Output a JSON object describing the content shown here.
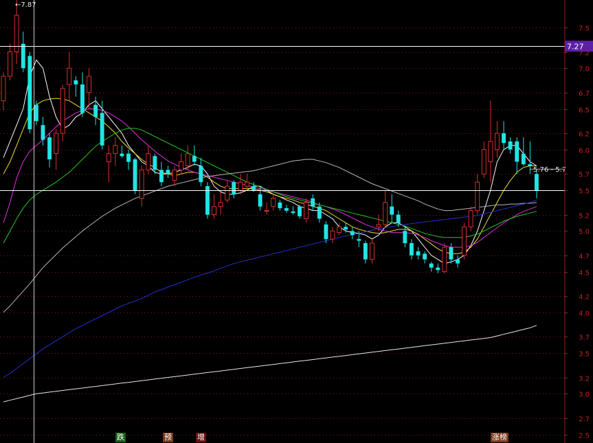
{
  "chart_data": {
    "type": "candlestick",
    "ylim": [
      2.45,
      7.85
    ],
    "y_ticks": [
      "7.5",
      "7.2",
      "7.0",
      "6.7",
      "6.5",
      "6.2",
      "6.0",
      "5.7",
      "5.5",
      "5.2",
      "5.0",
      "4.7",
      "4.5",
      "4.2",
      "4.0",
      "3.7",
      "3.5",
      "3.2",
      "3.0",
      "2.7",
      "2.5"
    ],
    "grid": true,
    "price_tag": "7.27",
    "high_label": "7.87",
    "cursor_label": "5.76 - 5.7",
    "hlines": [
      7.27,
      5.5
    ],
    "colors": {
      "up": "#d83030",
      "down": "#22e4e4",
      "tag_bg": "#5b1fa8",
      "axis": "#a61c1c"
    },
    "candles": [
      [
        6.6,
        6.95,
        6.48,
        6.9
      ],
      [
        6.9,
        7.3,
        6.85,
        7.2
      ],
      [
        7.2,
        7.85,
        7.05,
        7.65
      ],
      [
        7.3,
        7.45,
        6.95,
        7.0
      ],
      [
        7.15,
        7.2,
        6.2,
        6.25
      ],
      [
        6.55,
        6.6,
        6.3,
        6.35
      ],
      [
        6.3,
        6.4,
        6.05,
        6.12
      ],
      [
        6.15,
        6.2,
        5.78,
        5.88
      ],
      [
        5.95,
        6.25,
        5.75,
        6.2
      ],
      [
        6.2,
        6.8,
        6.1,
        6.75
      ],
      [
        6.8,
        7.2,
        6.6,
        7.0
      ],
      [
        6.85,
        6.9,
        6.65,
        6.8
      ],
      [
        6.8,
        6.95,
        6.4,
        6.45
      ],
      [
        6.7,
        7.0,
        6.5,
        6.9
      ],
      [
        6.55,
        6.65,
        6.3,
        6.4
      ],
      [
        6.45,
        6.6,
        6.0,
        6.05
      ],
      [
        5.85,
        6.05,
        5.6,
        5.95
      ],
      [
        5.95,
        6.15,
        5.8,
        6.05
      ],
      [
        5.95,
        6.05,
        5.9,
        5.92
      ],
      [
        5.95,
        6.0,
        5.75,
        5.85
      ],
      [
        5.88,
        5.9,
        5.45,
        5.5
      ],
      [
        5.4,
        5.8,
        5.3,
        5.75
      ],
      [
        5.75,
        6.05,
        5.7,
        5.95
      ],
      [
        5.92,
        5.95,
        5.7,
        5.75
      ],
      [
        5.75,
        5.85,
        5.55,
        5.6
      ],
      [
        5.75,
        5.8,
        5.65,
        5.7
      ],
      [
        5.62,
        5.8,
        5.55,
        5.75
      ],
      [
        5.75,
        5.95,
        5.7,
        5.85
      ],
      [
        5.8,
        6.05,
        5.75,
        5.95
      ],
      [
        5.92,
        6.05,
        5.8,
        5.85
      ],
      [
        5.8,
        5.9,
        5.55,
        5.6
      ],
      [
        5.55,
        5.6,
        5.15,
        5.2
      ],
      [
        5.2,
        5.45,
        5.15,
        5.3
      ],
      [
        5.3,
        5.5,
        5.2,
        5.35
      ],
      [
        5.38,
        5.62,
        5.35,
        5.55
      ],
      [
        5.6,
        5.62,
        5.4,
        5.45
      ],
      [
        5.5,
        5.7,
        5.45,
        5.6
      ],
      [
        5.55,
        5.7,
        5.5,
        5.6
      ],
      [
        5.55,
        5.6,
        5.48,
        5.5
      ],
      [
        5.45,
        5.55,
        5.25,
        5.3
      ],
      [
        5.25,
        5.35,
        5.2,
        5.25
      ],
      [
        5.3,
        5.45,
        5.25,
        5.4
      ],
      [
        5.35,
        5.38,
        5.25,
        5.28
      ],
      [
        5.28,
        5.32,
        5.22,
        5.25
      ],
      [
        5.24,
        5.3,
        5.2,
        5.22
      ],
      [
        5.3,
        5.32,
        5.15,
        5.18
      ],
      [
        5.15,
        5.4,
        5.1,
        5.35
      ],
      [
        5.4,
        5.45,
        5.25,
        5.3
      ],
      [
        5.3,
        5.35,
        5.1,
        5.15
      ],
      [
        5.08,
        5.12,
        4.85,
        4.9
      ],
      [
        4.9,
        5.05,
        4.85,
        5.0
      ],
      [
        4.98,
        5.1,
        4.95,
        5.05
      ],
      [
        5.05,
        5.1,
        4.98,
        5.02
      ],
      [
        5.0,
        5.05,
        4.9,
        4.95
      ],
      [
        4.9,
        5.0,
        4.8,
        4.88
      ],
      [
        4.85,
        4.88,
        4.6,
        4.65
      ],
      [
        4.65,
        4.9,
        4.6,
        4.85
      ],
      [
        5.05,
        5.2,
        5.0,
        5.08
      ],
      [
        5.08,
        5.5,
        5.05,
        5.35
      ],
      [
        5.3,
        5.45,
        5.1,
        5.2
      ],
      [
        5.2,
        5.25,
        5.05,
        5.1
      ],
      [
        5.0,
        5.05,
        4.8,
        4.85
      ],
      [
        4.85,
        4.9,
        4.65,
        4.7
      ],
      [
        4.75,
        4.8,
        4.65,
        4.7
      ],
      [
        4.72,
        4.75,
        4.6,
        4.65
      ],
      [
        4.6,
        4.62,
        4.5,
        4.55
      ],
      [
        4.55,
        4.6,
        4.48,
        4.52
      ],
      [
        4.5,
        4.85,
        4.48,
        4.8
      ],
      [
        4.8,
        4.85,
        4.6,
        4.65
      ],
      [
        4.65,
        4.7,
        4.55,
        4.6
      ],
      [
        4.7,
        5.1,
        4.65,
        5.05
      ],
      [
        5.05,
        5.3,
        5.0,
        5.25
      ],
      [
        5.25,
        5.7,
        5.2,
        5.6
      ],
      [
        5.7,
        6.1,
        5.65,
        6.0
      ],
      [
        5.85,
        6.6,
        5.6,
        6.1
      ],
      [
        6.0,
        6.35,
        5.9,
        6.2
      ],
      [
        6.2,
        6.35,
        6.0,
        6.08
      ],
      [
        6.1,
        6.15,
        5.95,
        6.0
      ],
      [
        6.1,
        6.15,
        5.7,
        5.85
      ],
      [
        5.95,
        6.15,
        5.8,
        5.82
      ],
      [
        5.82,
        6.1,
        5.7,
        5.8
      ],
      [
        5.7,
        5.75,
        5.4,
        5.5
      ]
    ],
    "ma_lines": [
      {
        "color": "#ffffff",
        "values": [
          5.9,
          6.1,
          6.3,
          6.5,
          6.9,
          7.1,
          7.0,
          6.65,
          6.4,
          6.25,
          6.3,
          6.4,
          6.45,
          6.55,
          6.6,
          6.5,
          6.4,
          6.3,
          6.2,
          6.05,
          5.95,
          5.85,
          5.8,
          5.72,
          5.7,
          5.7,
          5.72,
          5.75,
          5.78,
          5.82,
          5.8,
          5.7,
          5.55,
          5.48,
          5.45,
          5.45,
          5.47,
          5.5,
          5.55,
          5.55,
          5.5,
          5.45,
          5.42,
          5.38,
          5.35,
          5.3,
          5.28,
          5.25,
          5.25,
          5.2,
          5.15,
          5.05,
          5.0,
          4.98,
          4.97,
          4.95,
          4.9,
          4.95,
          5.05,
          5.1,
          5.1,
          5.05,
          5.0,
          4.9,
          4.8,
          4.7,
          4.65,
          4.6,
          4.62,
          4.65,
          4.7,
          4.82,
          5.0,
          5.25,
          5.5,
          5.85,
          6.0,
          6.05,
          6.05,
          5.95,
          5.85,
          5.8
        ]
      },
      {
        "color": "#f0e030",
        "values": [
          5.7,
          5.85,
          6.05,
          6.25,
          6.45,
          6.55,
          6.6,
          6.62,
          6.63,
          6.62,
          6.6,
          6.55,
          6.5,
          6.45,
          6.4,
          6.35,
          6.28,
          6.2,
          6.1,
          6.02,
          5.95,
          5.88,
          5.82,
          5.78,
          5.72,
          5.7,
          5.68,
          5.7,
          5.72,
          5.72,
          5.7,
          5.66,
          5.6,
          5.55,
          5.52,
          5.52,
          5.52,
          5.52,
          5.52,
          5.5,
          5.48,
          5.45,
          5.42,
          5.4,
          5.38,
          5.35,
          5.33,
          5.3,
          5.28,
          5.25,
          5.2,
          5.15,
          5.1,
          5.05,
          5.02,
          5.0,
          4.98,
          4.97,
          4.98,
          5.0,
          5.02,
          5.02,
          5.0,
          4.96,
          4.9,
          4.84,
          4.78,
          4.74,
          4.72,
          4.72,
          4.74,
          4.8,
          4.9,
          5.05,
          5.2,
          5.35,
          5.5,
          5.62,
          5.72,
          5.78,
          5.8,
          5.8
        ]
      },
      {
        "color": "#e030e0",
        "values": [
          5.1,
          5.35,
          5.65,
          5.85,
          5.98,
          6.05,
          6.12,
          6.2,
          6.28,
          6.35,
          6.4,
          6.45,
          6.48,
          6.5,
          6.5,
          6.48,
          6.45,
          6.4,
          6.35,
          6.28,
          6.2,
          6.12,
          6.05,
          5.98,
          5.92,
          5.86,
          5.82,
          5.78,
          5.75,
          5.72,
          5.7,
          5.68,
          5.66,
          5.64,
          5.62,
          5.6,
          5.58,
          5.56,
          5.54,
          5.52,
          5.5,
          5.48,
          5.46,
          5.44,
          5.42,
          5.4,
          5.38,
          5.35,
          5.32,
          5.3,
          5.27,
          5.24,
          5.2,
          5.16,
          5.12,
          5.08,
          5.05,
          5.02,
          5.0,
          4.98,
          4.98,
          4.98,
          4.97,
          4.95,
          4.92,
          4.88,
          4.85,
          4.82,
          4.8,
          4.8,
          4.8,
          4.82,
          4.86,
          4.92,
          4.98,
          5.04,
          5.1,
          5.15,
          5.2,
          5.24,
          5.27,
          5.3
        ]
      },
      {
        "color": "#28c828",
        "values": [
          4.85,
          5.0,
          5.15,
          5.28,
          5.38,
          5.45,
          5.5,
          5.55,
          5.6,
          5.66,
          5.72,
          5.8,
          5.88,
          5.96,
          6.04,
          6.1,
          6.15,
          6.2,
          6.24,
          6.26,
          6.26,
          6.24,
          6.2,
          6.16,
          6.12,
          6.08,
          6.04,
          6.0,
          5.96,
          5.92,
          5.88,
          5.84,
          5.8,
          5.76,
          5.72,
          5.68,
          5.64,
          5.6,
          5.57,
          5.54,
          5.51,
          5.48,
          5.45,
          5.42,
          5.4,
          5.38,
          5.36,
          5.34,
          5.32,
          5.3,
          5.28,
          5.26,
          5.24,
          5.22,
          5.2,
          5.18,
          5.16,
          5.14,
          5.12,
          5.1,
          5.08,
          5.06,
          5.03,
          5.0,
          4.97,
          4.95,
          4.93,
          4.92,
          4.92,
          4.92,
          4.92,
          4.94,
          4.96,
          5.0,
          5.04,
          5.08,
          5.12,
          5.15,
          5.18,
          5.2,
          5.22,
          5.24
        ]
      },
      {
        "color": "#b8b8b8",
        "values": [
          4.0,
          4.08,
          4.17,
          4.26,
          4.35,
          4.45,
          4.55,
          4.63,
          4.71,
          4.79,
          4.86,
          4.93,
          5.0,
          5.06,
          5.12,
          5.18,
          5.23,
          5.28,
          5.32,
          5.36,
          5.4,
          5.43,
          5.46,
          5.49,
          5.52,
          5.55,
          5.57,
          5.59,
          5.61,
          5.63,
          5.65,
          5.67,
          5.68,
          5.69,
          5.7,
          5.71,
          5.72,
          5.73,
          5.74,
          5.76,
          5.78,
          5.8,
          5.82,
          5.84,
          5.86,
          5.87,
          5.88,
          5.88,
          5.86,
          5.84,
          5.81,
          5.78,
          5.74,
          5.7,
          5.66,
          5.62,
          5.58,
          5.55,
          5.52,
          5.49,
          5.46,
          5.43,
          5.4,
          5.37,
          5.33,
          5.3,
          5.27,
          5.25,
          5.25,
          5.26,
          5.27,
          5.28,
          5.29,
          5.3,
          5.31,
          5.32,
          5.32,
          5.33,
          5.33,
          5.34,
          5.34,
          5.35
        ]
      },
      {
        "color": "#2830c8",
        "values": [
          3.2,
          3.25,
          3.31,
          3.37,
          3.43,
          3.49,
          3.55,
          3.6,
          3.65,
          3.7,
          3.75,
          3.8,
          3.84,
          3.88,
          3.92,
          3.96,
          4.0,
          4.04,
          4.08,
          4.11,
          4.14,
          4.17,
          4.21,
          4.25,
          4.28,
          4.31,
          4.34,
          4.37,
          4.4,
          4.43,
          4.46,
          4.48,
          4.51,
          4.54,
          4.57,
          4.6,
          4.62,
          4.64,
          4.66,
          4.68,
          4.7,
          4.72,
          4.74,
          4.76,
          4.78,
          4.8,
          4.82,
          4.84,
          4.86,
          4.88,
          4.9,
          4.92,
          4.94,
          4.95,
          4.97,
          4.99,
          5.01,
          5.03,
          5.04,
          5.05,
          5.07,
          5.08,
          5.09,
          5.1,
          5.11,
          5.12,
          5.13,
          5.14,
          5.15,
          5.16,
          5.17,
          5.18,
          5.19,
          5.21,
          5.23,
          5.25,
          5.27,
          5.29,
          5.31,
          5.33,
          5.35,
          5.38
        ]
      },
      {
        "color": "#e8e8e8",
        "values": [
          2.9,
          2.92,
          2.94,
          2.96,
          2.98,
          3.0,
          3.01,
          3.02,
          3.03,
          3.04,
          3.05,
          3.06,
          3.07,
          3.08,
          3.09,
          3.1,
          3.11,
          3.12,
          3.13,
          3.14,
          3.15,
          3.16,
          3.17,
          3.18,
          3.19,
          3.2,
          3.21,
          3.22,
          3.23,
          3.24,
          3.25,
          3.26,
          3.27,
          3.28,
          3.29,
          3.3,
          3.31,
          3.32,
          3.33,
          3.34,
          3.35,
          3.36,
          3.37,
          3.38,
          3.39,
          3.4,
          3.41,
          3.42,
          3.43,
          3.44,
          3.45,
          3.46,
          3.47,
          3.48,
          3.49,
          3.5,
          3.51,
          3.52,
          3.53,
          3.54,
          3.55,
          3.56,
          3.57,
          3.58,
          3.59,
          3.6,
          3.61,
          3.62,
          3.63,
          3.64,
          3.65,
          3.66,
          3.67,
          3.68,
          3.69,
          3.71,
          3.73,
          3.75,
          3.77,
          3.79,
          3.81,
          3.84
        ]
      }
    ],
    "markers": [
      {
        "label": "跌",
        "bg": "#1a5e1a",
        "fg": "#ffffff"
      },
      {
        "label": "预",
        "bg": "#7a3a1a",
        "fg": "#ffffff"
      },
      {
        "label": "增",
        "bg": "#6a1010",
        "fg": "#ffffff"
      },
      {
        "label": "涨榜",
        "bg": "#7a3a1a",
        "fg": "#ffffff"
      }
    ]
  }
}
